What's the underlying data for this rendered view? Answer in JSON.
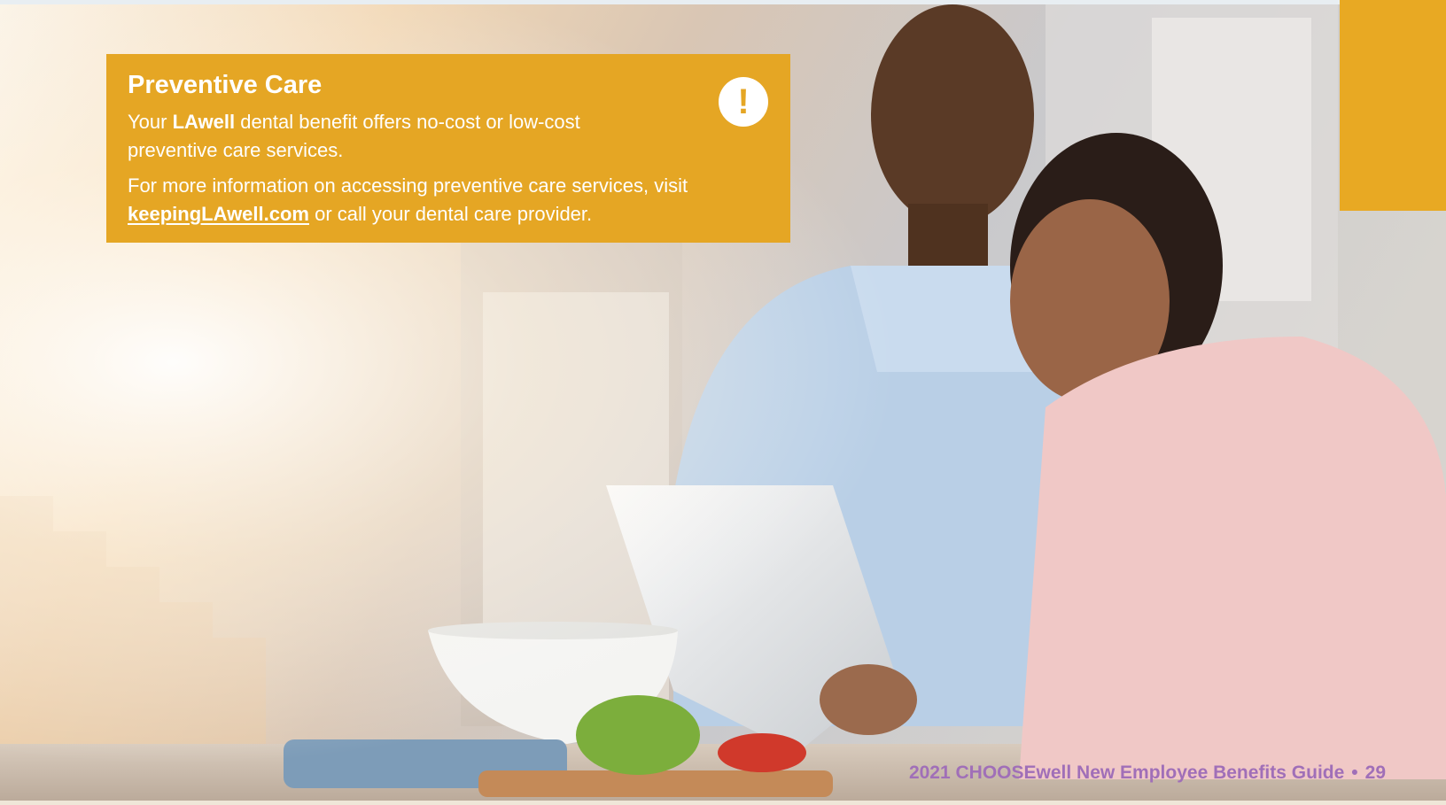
{
  "callout": {
    "title": "Preventive Care",
    "para1_prefix": "Your ",
    "para1_brand": "LAwell",
    "para1_suffix": " dental benefit offers no-cost or low-cost preventive care services.",
    "para2_prefix": "For more information on accessing preventive care services, visit ",
    "para2_link": "keepingLAwell.com",
    "para2_suffix": " or call your dental care provider.",
    "icon": "exclamation-icon",
    "icon_glyph": "!"
  },
  "footer": {
    "guide_title": "2021 CHOOSEwell New Employee Benefits Guide",
    "separator": "•",
    "page_number": "29"
  },
  "colors": {
    "accent": "#e5a624",
    "footer_text": "#a06fb8"
  }
}
